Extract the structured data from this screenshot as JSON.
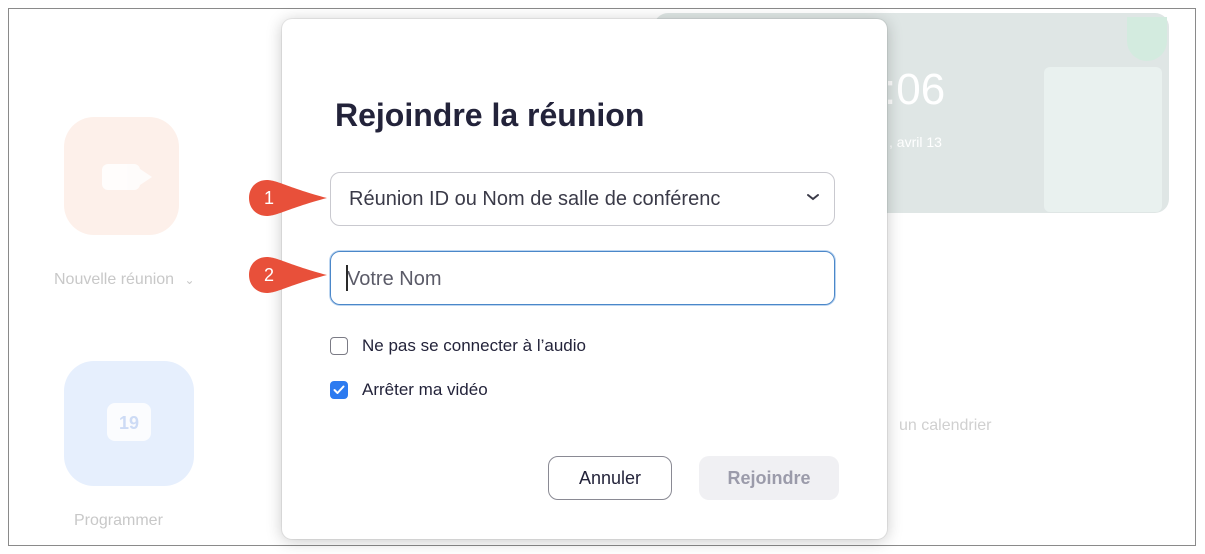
{
  "background": {
    "new_meeting_label": "Nouvelle réunion",
    "new_meeting_chevron": "⌄",
    "schedule_label": "Programmer",
    "calendar_day": "19",
    "clock_time": ":06",
    "clock_date": ", avril 13",
    "calendar_text": "un calendrier",
    "icons": [
      "video-camera-icon",
      "calendar-icon"
    ]
  },
  "dialog": {
    "title": "Rejoindre la réunion",
    "meeting_field": {
      "placeholder": "Réunion ID ou Nom de salle de conférenc",
      "icon": "chevron-down-icon"
    },
    "name_field": {
      "value": "",
      "placeholder": "Votre Nom"
    },
    "checkboxes": [
      {
        "label": "Ne pas se connecter à l’audio",
        "checked": false
      },
      {
        "label": "Arrêter ma vidéo",
        "checked": true
      }
    ],
    "buttons": {
      "cancel": "Annuler",
      "join": "Rejoindre"
    }
  },
  "annotations": {
    "marker_1": "1",
    "marker_2": "2",
    "marker_color": "#e8503a"
  },
  "colors": {
    "accent": "#2d7bf0",
    "title": "#23233a"
  }
}
